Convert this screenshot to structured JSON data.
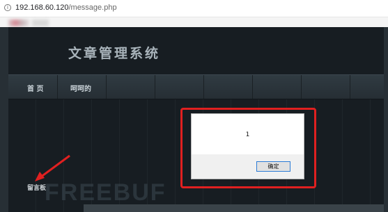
{
  "browser": {
    "url_host": "192.168.60.120",
    "url_path": "/message.php",
    "info_icon": "info-icon"
  },
  "site": {
    "title": "文章管理系统",
    "nav": [
      {
        "label": "首 页"
      },
      {
        "label": "呵呵的"
      }
    ],
    "section_label": "留言板"
  },
  "alert": {
    "message": "1",
    "ok_label": "确定"
  },
  "watermark": "FREEBUF",
  "colors": {
    "highlight": "#e02020",
    "page_bg": "#171d22",
    "button_border": "#2b7bd6"
  }
}
